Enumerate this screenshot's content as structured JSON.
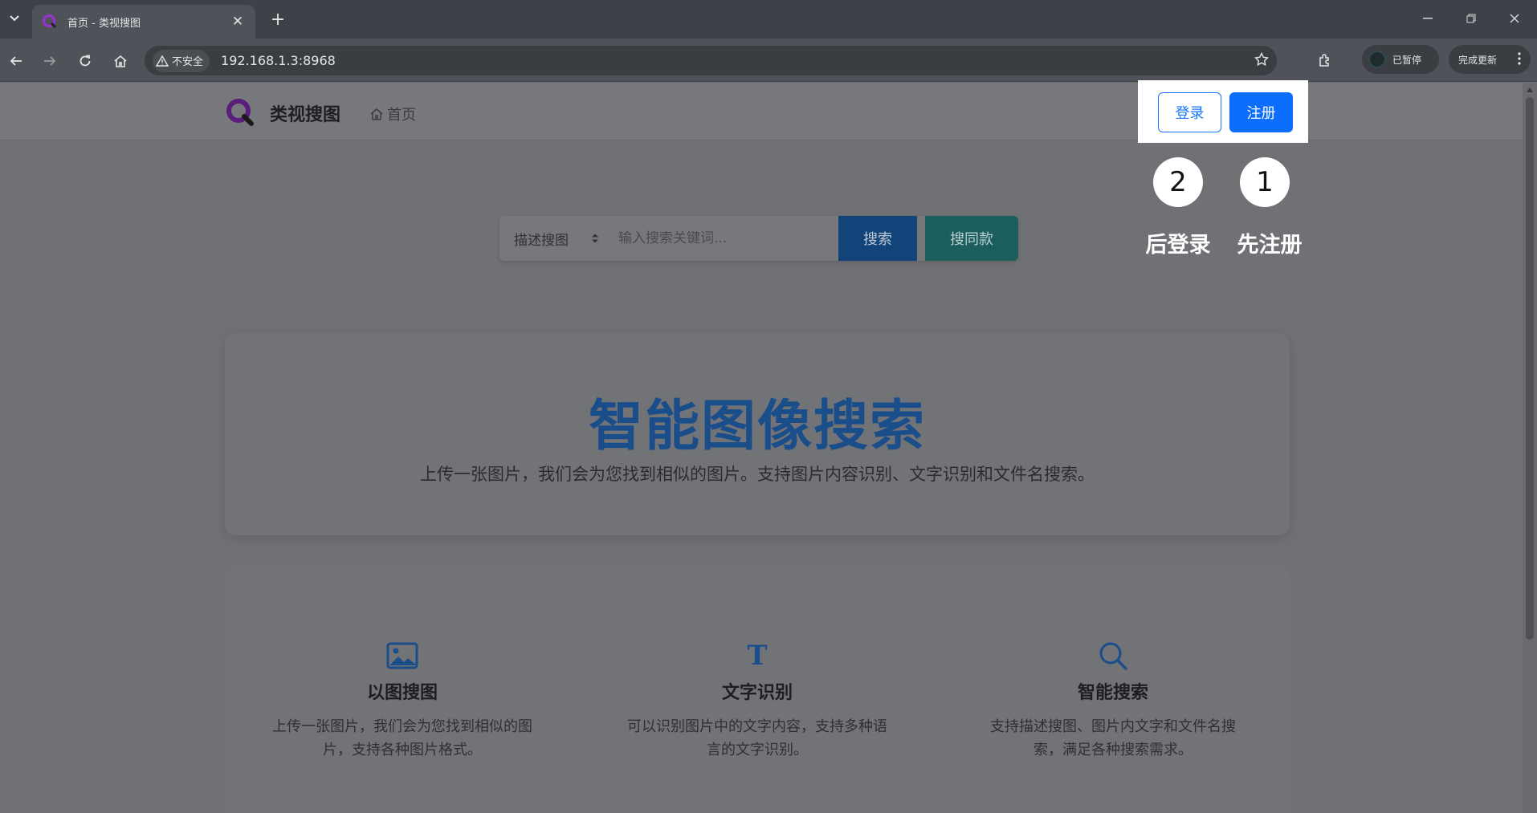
{
  "browser": {
    "tab_title": "首页 - 类视搜图",
    "address": "192.168.1.3:8968",
    "security_label": "不安全",
    "profile_label": "已暂停",
    "update_label": "完成更新"
  },
  "site": {
    "brand": "类视搜图",
    "nav_home": "首页",
    "login_label": "登录",
    "register_label": "注册"
  },
  "search": {
    "mode": "描述搜图",
    "placeholder": "输入搜索关键词...",
    "search_label": "搜索",
    "same_label": "搜同款"
  },
  "hero": {
    "title": "智能图像搜索",
    "subtitle": "上传一张图片，我们会为您找到相似的图片。支持图片内容识别、文字识别和文件名搜索。"
  },
  "features": [
    {
      "icon": "image-icon",
      "title": "以图搜图",
      "desc": "上传一张图片，我们会为您找到相似的图片，支持各种图片格式。"
    },
    {
      "icon": "text-icon",
      "glyph": "T",
      "title": "文字识别",
      "desc": "可以识别图片中的文字内容，支持多种语言的文字识别。"
    },
    {
      "icon": "search-icon",
      "title": "智能搜索",
      "desc": "支持描述搜图、图片内文字和文件名搜索，满足各种搜索需求。"
    }
  ],
  "annotations": [
    {
      "number": "2",
      "label": "后登录"
    },
    {
      "number": "1",
      "label": "先注册"
    }
  ],
  "colors": {
    "primary": "#0d6efd",
    "hero_title": "#1a4e8a",
    "overlay_bg": "#707175"
  }
}
